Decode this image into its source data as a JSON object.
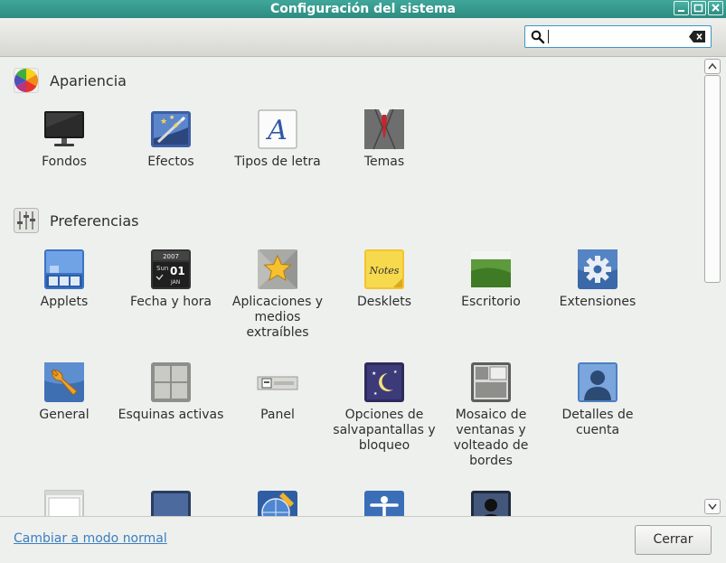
{
  "window": {
    "title": "Configuración del sistema"
  },
  "search": {
    "value": "",
    "placeholder": ""
  },
  "sections": [
    {
      "title": "Apariencia",
      "icon": "appearance-rainbow-icon",
      "items": [
        {
          "label": "Fondos",
          "icon": "monitor-icon"
        },
        {
          "label": "Efectos",
          "icon": "magic-wand-icon"
        },
        {
          "label": "Tipos de letra",
          "icon": "font-letter-icon"
        },
        {
          "label": "Temas",
          "icon": "suit-tie-icon"
        }
      ]
    },
    {
      "title": "Preferencias",
      "icon": "sliders-icon",
      "items": [
        {
          "label": "Applets",
          "icon": "panel-applets-icon"
        },
        {
          "label": "Fecha y hora",
          "icon": "calendar-clock-icon"
        },
        {
          "label": "Aplicaciones y medios extraíbles",
          "icon": "star-media-icon"
        },
        {
          "label": "Desklets",
          "icon": "sticky-note-icon"
        },
        {
          "label": "Escritorio",
          "icon": "desktop-icon"
        },
        {
          "label": "Extensiones",
          "icon": "gear-icon"
        },
        {
          "label": "General",
          "icon": "wrench-icon"
        },
        {
          "label": "Esquinas activas",
          "icon": "hot-corners-icon"
        },
        {
          "label": "Panel",
          "icon": "panel-icon"
        },
        {
          "label": "Opciones de salvapantallas y bloqueo",
          "icon": "screensaver-moon-icon"
        },
        {
          "label": "Mosaico de ventanas y volteado de bordes",
          "icon": "window-tiling-icon"
        },
        {
          "label": "Detalles de cuenta",
          "icon": "user-account-icon"
        }
      ]
    }
  ],
  "partial_row_icons": [
    "document-window-icon",
    "display-icon",
    "globe-pencil-icon",
    "accessibility-icon",
    "user-silhouette-icon"
  ],
  "calendar_icon": {
    "year": "2007",
    "weekday": "Sun",
    "day": "01",
    "month": "JAN"
  },
  "footer": {
    "mode_link": "Cambiar a modo normal",
    "close_label": "Cerrar"
  },
  "colors": {
    "titlebar": "#2d8c80",
    "link": "#3b7ebf",
    "focus": "#3e96c8"
  }
}
